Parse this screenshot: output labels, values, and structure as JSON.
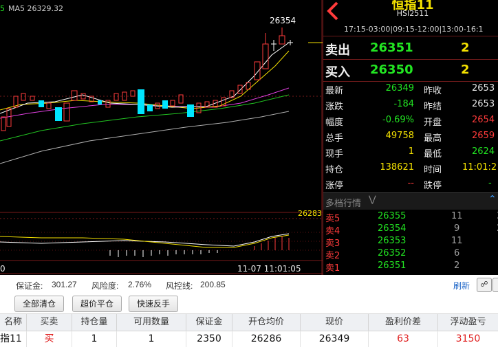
{
  "chart": {
    "ma_prefix": "5",
    "ma_label": "MA5 26329.32",
    "peak_label": "26354",
    "level_label": "26283",
    "time_label": "11-07 11:01:05",
    "left_axis_zero": "0"
  },
  "quote": {
    "title": "恒指11",
    "code": "HSI2511",
    "sessions": "17:15-03:00|09:15-12:00|13:00-16:1",
    "sell_label": "卖出",
    "sell_price": "26351",
    "sell_qty": "2",
    "buy_label": "买入",
    "buy_price": "26350",
    "buy_qty": "2",
    "rows": [
      {
        "l1": "最新",
        "v1": "26349",
        "l2": "昨收",
        "v2": "2653"
      },
      {
        "l1": "涨跌",
        "v1": "-184",
        "l2": "昨结",
        "v2": "2653"
      },
      {
        "l1": "幅度",
        "v1": "-0.69%",
        "l2": "开盘",
        "v2": "2654"
      },
      {
        "l1": "总手",
        "v1": "49758",
        "l2": "最高",
        "v2": "2659"
      },
      {
        "l1": "现手",
        "v1": "1",
        "l2": "最低",
        "v2": "2624"
      },
      {
        "l1": "持仓",
        "v1": "138621",
        "l2": "时间",
        "v2": "11:01:2"
      },
      {
        "l1": "涨停",
        "v1": "--",
        "l2": "跌停",
        "v2": "-"
      }
    ],
    "depth_title": "多档行情",
    "depth": [
      {
        "label": "卖5",
        "price": "26355",
        "qty": "11",
        "extra": "3"
      },
      {
        "label": "卖4",
        "price": "26354",
        "qty": "9",
        "extra": "2"
      },
      {
        "label": "卖3",
        "price": "26353",
        "qty": "11",
        "extra": ""
      },
      {
        "label": "卖2",
        "price": "26352",
        "qty": "6",
        "extra": ""
      },
      {
        "label": "卖1",
        "price": "26351",
        "qty": "2",
        "extra": ""
      }
    ]
  },
  "account": {
    "margin_label": "保证金:",
    "margin_value": "301.27",
    "risk_label": "风险度:",
    "risk_value": "2.76%",
    "control_label": "风控线:",
    "control_value": "200.85",
    "refresh_label": "刷新"
  },
  "buttons": {
    "close_all": "全部清仓",
    "super_close": "超价平仓",
    "quick_reverse": "快速反手"
  },
  "table": {
    "headers": [
      "名称",
      "买卖",
      "持仓量",
      "可用数量",
      "保证金",
      "开仓均价",
      "现价",
      "盈利价差",
      "浮动盈亏"
    ],
    "row": [
      "指11",
      "买",
      "1",
      "1",
      "2350",
      "26286",
      "26349",
      "63",
      "3150"
    ]
  },
  "colors": {
    "up": "#ff3b3b",
    "down": "#22e522",
    "cyan_candle": "#00e5ff",
    "price_yellow": "#f4e100"
  }
}
